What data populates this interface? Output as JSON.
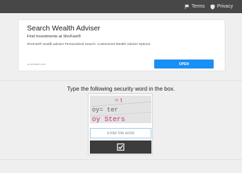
{
  "nav": {
    "terms": {
      "label": "Terms",
      "icon": "flag-icon"
    },
    "privacy": {
      "label": "Privacy",
      "icon": "shield-icon"
    }
  },
  "ad": {
    "title": "Search Wealth Adviser",
    "subtitle": "Find Investments at ShoFast®",
    "description": "ShoFast® wealth adviser Personalized Search. Customized Wealth Adviser Options.",
    "display_url": "us.shofast.com",
    "button_label": "OPEN",
    "accent_color": "#1a8ff5"
  },
  "captcha": {
    "instruction": "Type the following security word in the box.",
    "image_text_line1": "oy= ter",
    "image_text_line2": "oy Sters",
    "input_value": "",
    "input_placeholder": "Enter the word",
    "submit_icon": "checkbox-checked-icon"
  },
  "colors": {
    "topbar": "#474747",
    "background": "#efefef",
    "submit_button": "#3c3c3c"
  }
}
